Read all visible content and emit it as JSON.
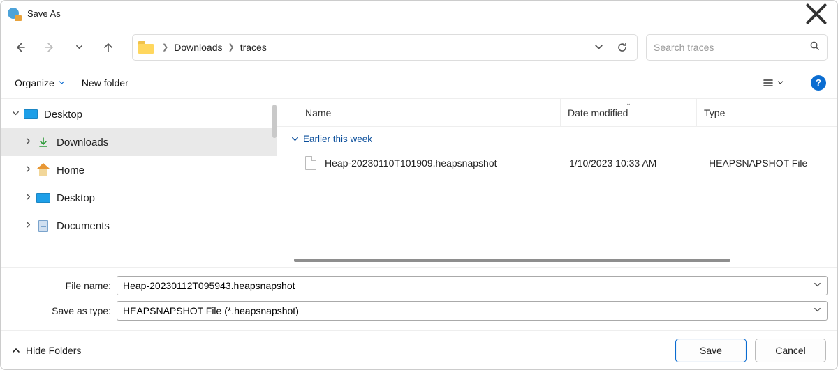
{
  "window": {
    "title": "Save As"
  },
  "path": {
    "segments": [
      "Downloads",
      "traces"
    ]
  },
  "search": {
    "placeholder": "Search traces"
  },
  "toolbar": {
    "organize": "Organize",
    "new_folder": "New folder"
  },
  "sidebar": {
    "items": [
      {
        "label": "Desktop"
      },
      {
        "label": "Downloads"
      },
      {
        "label": "Home"
      },
      {
        "label": "Desktop"
      },
      {
        "label": "Documents"
      }
    ]
  },
  "columns": {
    "name": "Name",
    "date": "Date modified",
    "type": "Type"
  },
  "group": {
    "label": "Earlier this week"
  },
  "files": [
    {
      "name": "Heap-20230110T101909.heapsnapshot",
      "date": "1/10/2023 10:33 AM",
      "type": "HEAPSNAPSHOT File"
    }
  ],
  "form": {
    "file_name_label": "File name:",
    "file_name_value": "Heap-20230112T095943.heapsnapshot",
    "save_type_label": "Save as type:",
    "save_type_value": "HEAPSNAPSHOT File (*.heapsnapshot)"
  },
  "footer": {
    "hide_folders": "Hide Folders",
    "save": "Save",
    "cancel": "Cancel"
  }
}
